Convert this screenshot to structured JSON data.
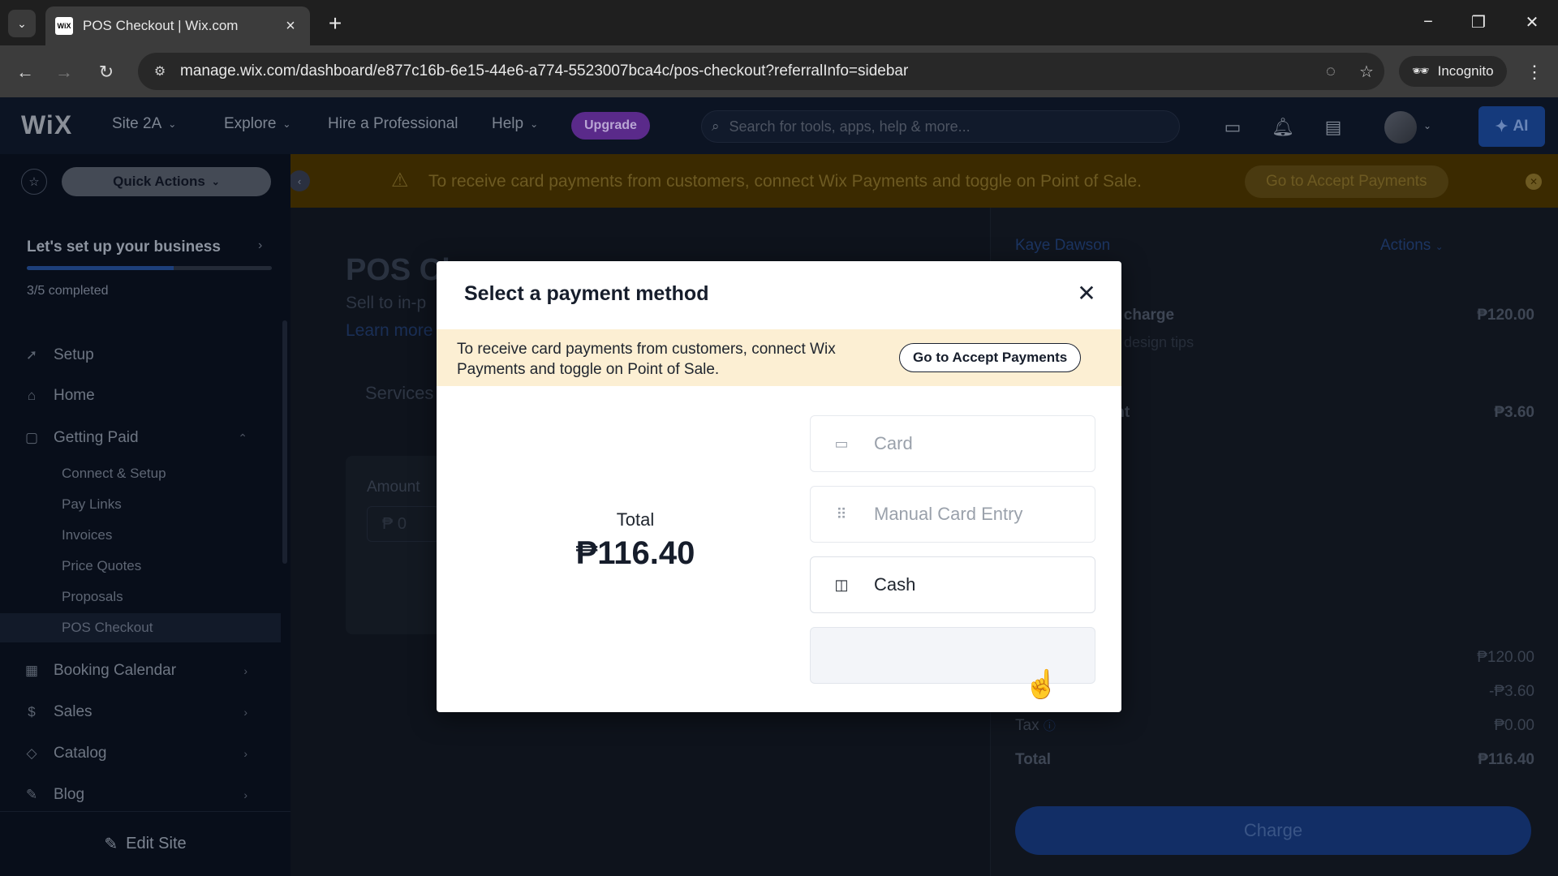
{
  "browser": {
    "tab_title": "POS Checkout | Wix.com",
    "favicon_text": "WiX",
    "url": "manage.wix.com/dashboard/e877c16b-6e15-44e6-a774-5523007bca4c/pos-checkout?referralInfo=sidebar",
    "incognito_label": "Incognito"
  },
  "wix": {
    "logo": "WiX",
    "site_menu": "Site 2A",
    "explore_menu": "Explore",
    "hire_link": "Hire a Professional",
    "help_menu": "Help",
    "upgrade_label": "Upgrade",
    "search_placeholder": "Search for tools, apps, help & more...",
    "ai_label": "AI"
  },
  "sidebar": {
    "quick_actions": "Quick Actions",
    "setup_title": "Let's set up your business",
    "setup_progress": "3/5 completed",
    "setup_progress_fraction": 0.6,
    "items": [
      {
        "label": "Setup",
        "icon": "rocket-icon"
      },
      {
        "label": "Home",
        "icon": "home-icon"
      },
      {
        "label": "Getting Paid",
        "icon": "document-icon"
      }
    ],
    "sub_items": [
      "Connect & Setup",
      "Pay Links",
      "Invoices",
      "Price Quotes",
      "Proposals",
      "POS Checkout"
    ],
    "lower_items": [
      {
        "label": "Booking Calendar",
        "icon": "calendar-icon"
      },
      {
        "label": "Sales",
        "icon": "dollar-icon"
      },
      {
        "label": "Catalog",
        "icon": "tag-icon"
      },
      {
        "label": "Blog",
        "icon": "pen-icon"
      }
    ],
    "edit_site": "Edit Site"
  },
  "banner": {
    "text": "To receive card payments from customers, connect Wix Payments and toggle on Point of Sale.",
    "button": "Go to Accept Payments"
  },
  "background": {
    "page_title": "POS Ch",
    "subtitle": "Sell to in-p",
    "learn_more": "Learn more",
    "services_tab": "Services",
    "amount_label": "Amount",
    "amount_value": "₱ 0",
    "customer": "Kaye Dawson",
    "actions": "Actions",
    "item_name": "om charge",
    "item_price": "₱120.00",
    "item_note": "uct design tips",
    "discount_name": "ount",
    "discount_value": "₱3.60",
    "subtotal_value": "₱120.00",
    "discount_line_value": "-₱3.60",
    "tax_label": "Tax",
    "tax_value": "₱0.00",
    "total_label": "Total",
    "total_value": "₱116.40",
    "charge_button": "Charge"
  },
  "modal": {
    "title": "Select a payment method",
    "notice_text": "To receive card payments from customers, connect Wix Payments and toggle on Point of Sale.",
    "notice_button": "Go to Accept Payments",
    "total_label": "Total",
    "total_value": "₱116.40",
    "options": [
      {
        "label": "Card",
        "icon": "credit-card-icon",
        "enabled": false
      },
      {
        "label": "Manual Card Entry",
        "icon": "keypad-icon",
        "enabled": false
      },
      {
        "label": "Cash",
        "icon": "cash-icon",
        "enabled": true
      }
    ]
  },
  "colors": {
    "accent_blue": "#116dff",
    "warning_bg": "#fcefd3",
    "upgrade_purple": "#7c3aed"
  }
}
